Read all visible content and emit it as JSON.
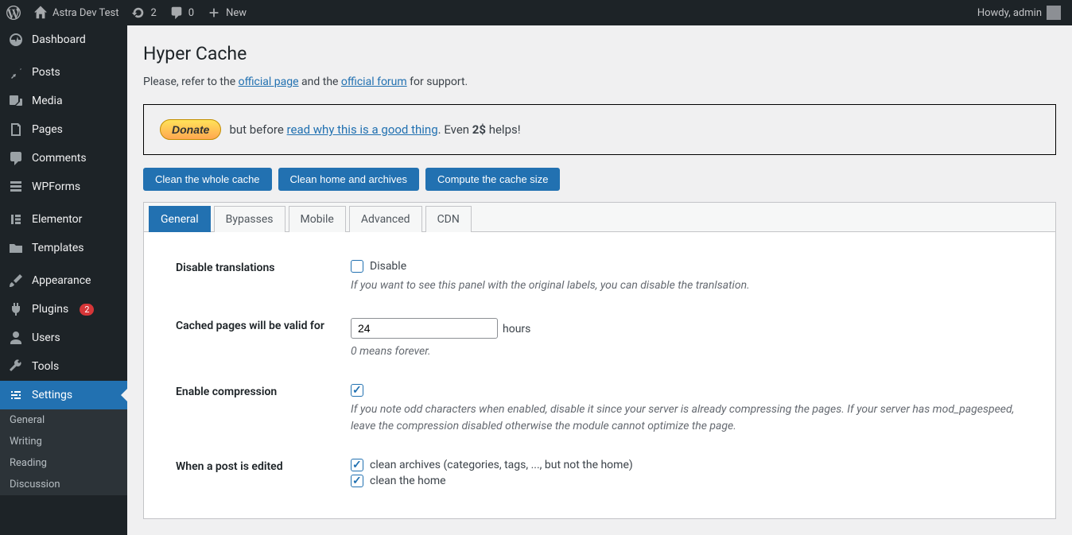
{
  "adminbar": {
    "site_name": "Astra Dev Test",
    "updates_count": "2",
    "comments_count": "0",
    "new_label": "New",
    "howdy": "Howdy, admin"
  },
  "sidebar": {
    "items": [
      {
        "label": "Dashboard"
      },
      {
        "label": "Posts"
      },
      {
        "label": "Media"
      },
      {
        "label": "Pages"
      },
      {
        "label": "Comments"
      },
      {
        "label": "WPForms"
      },
      {
        "label": "Elementor"
      },
      {
        "label": "Templates"
      },
      {
        "label": "Appearance"
      },
      {
        "label": "Plugins",
        "badge": "2"
      },
      {
        "label": "Users"
      },
      {
        "label": "Tools"
      },
      {
        "label": "Settings"
      }
    ],
    "submenu": [
      {
        "label": "General"
      },
      {
        "label": "Writing"
      },
      {
        "label": "Reading"
      },
      {
        "label": "Discussion"
      }
    ]
  },
  "page": {
    "title": "Hyper Cache",
    "subtext_pre": "Please, refer to the ",
    "official_page": "official page",
    "subtext_mid": " and the ",
    "official_forum": "official forum",
    "subtext_post": " for support.",
    "donate_label": "Donate",
    "donate_pre": "but before ",
    "donate_link": "read why this is a good thing",
    "donate_post_a": ". Even ",
    "donate_amount": "2$",
    "donate_post_b": " helps!",
    "buttons": {
      "clean_all": "Clean the whole cache",
      "clean_home": "Clean home and archives",
      "compute": "Compute the cache size"
    },
    "tabs": [
      "General",
      "Bypasses",
      "Mobile",
      "Advanced",
      "CDN"
    ],
    "form": {
      "disable_translations": {
        "label": "Disable translations",
        "cb_label": "Disable",
        "desc": "If you want to see this panel with the original labels, you can disable the tranlsation."
      },
      "valid_for": {
        "label": "Cached pages will be valid for",
        "value": "24",
        "unit": "hours",
        "desc": "0 means forever."
      },
      "enable_compression": {
        "label": "Enable compression",
        "desc": "If you note odd characters when enabled, disable it since your server is already compressing the pages. If your server has mod_pagespeed, leave the compression disabled otherwise the module cannot optimize the page."
      },
      "post_edited": {
        "label": "When a post is edited",
        "cb1": "clean archives (categories, tags, ..., but not the home)",
        "cb2": "clean the home"
      }
    }
  }
}
